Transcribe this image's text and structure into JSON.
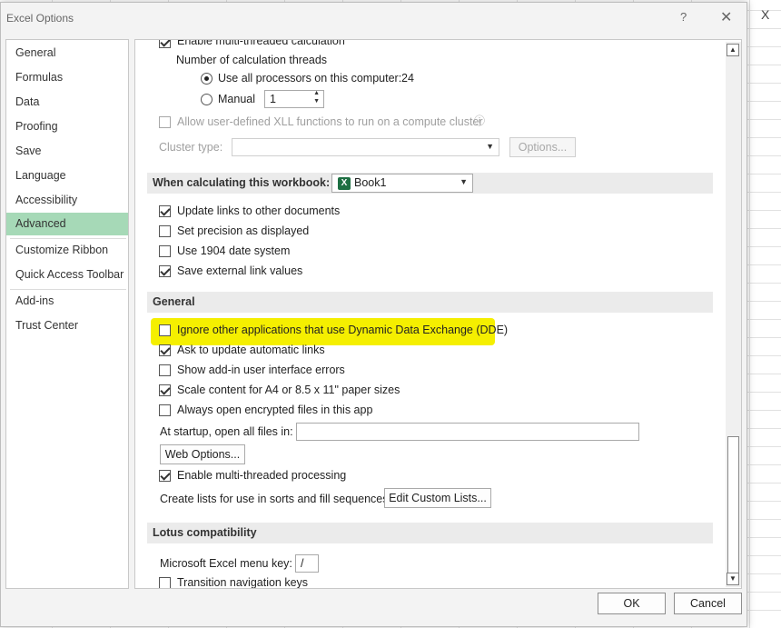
{
  "background": {
    "close_glyph": "X"
  },
  "dialog": {
    "title": "Excel Options",
    "help_label": "?",
    "close_label": "✕"
  },
  "nav": {
    "items": [
      {
        "label": "General"
      },
      {
        "label": "Formulas"
      },
      {
        "label": "Data"
      },
      {
        "label": "Proofing"
      },
      {
        "label": "Save"
      },
      {
        "label": "Language"
      },
      {
        "label": "Accessibility"
      },
      {
        "label": "Advanced"
      },
      {
        "label": "Customize Ribbon"
      },
      {
        "label": "Quick Access Toolbar"
      },
      {
        "label": "Add-ins"
      },
      {
        "label": "Trust Center"
      }
    ],
    "selected": "Advanced"
  },
  "formulas": {
    "multithread_label": "Enable multi-threaded calculation",
    "threads_label": "Number of calculation threads",
    "all_processors_label": "Use all processors on this computer:",
    "processor_count": "24",
    "manual_label": "Manual",
    "manual_value": "1",
    "xll_label": "Allow user-defined XLL functions to run on a compute cluster",
    "info_glyph": "ⓘ",
    "cluster_type_label": "Cluster type:",
    "options_button": "Options..."
  },
  "workbook": {
    "header_label": "When calculating this workbook:",
    "workbook_name": "Book1",
    "icon_letter": "X",
    "options": [
      {
        "label": "Update links to other documents",
        "checked": true
      },
      {
        "label": "Set precision as displayed",
        "checked": false
      },
      {
        "label": "Use 1904 date system",
        "checked": false
      },
      {
        "label": "Save external link values",
        "checked": true
      }
    ]
  },
  "general": {
    "header": "General",
    "options": [
      {
        "label": "Ignore other applications that use Dynamic Data Exchange (DDE)",
        "checked": false
      },
      {
        "label": "Ask to update automatic links",
        "checked": true
      },
      {
        "label": "Show add-in user interface errors",
        "checked": false
      },
      {
        "label": "Scale content for A4 or 8.5 x 11\" paper sizes",
        "checked": true
      },
      {
        "label": "Always open encrypted files in this app",
        "checked": false
      }
    ],
    "startup_label": "At startup, open all files in:",
    "startup_value": "",
    "web_options_button": "Web Options...",
    "multithread_processing_label": "Enable multi-threaded processing",
    "multithread_processing_checked": true,
    "custom_lists_label": "Create lists for use in sorts and fill sequences:",
    "custom_lists_button": "Edit Custom Lists..."
  },
  "lotus": {
    "header": "Lotus compatibility",
    "menu_key_label": "Microsoft Excel menu key:",
    "menu_key_value": "/",
    "transition_keys_label": "Transition navigation keys"
  },
  "footer": {
    "ok_label": "OK",
    "cancel_label": "Cancel"
  },
  "colors": {
    "nav_selected": "#a6d9b7",
    "highlight": "#f5ef00",
    "excel_green": "#1d6f42"
  }
}
